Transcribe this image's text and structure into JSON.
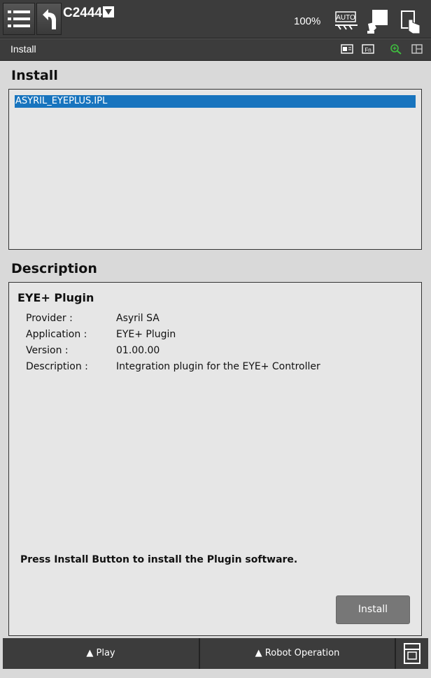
{
  "topbar": {
    "controller": "C2444",
    "speed": "100%",
    "auto_label": "AUTO"
  },
  "titlebar": {
    "title": "Install"
  },
  "install_section": {
    "heading": "Install",
    "files": [
      "ASYRIL_EYEPLUS.IPL"
    ],
    "selected_index": 0
  },
  "description_section": {
    "heading": "Description",
    "plugin_title": "EYE+ Plugin",
    "fields": [
      {
        "label": "Provider :",
        "value": "Asyril SA"
      },
      {
        "label": "Application :",
        "value": "EYE+ Plugin"
      },
      {
        "label": "Version :",
        "value": "01.00.00"
      },
      {
        "label": "Description :",
        "value": "Integration plugin for the EYE+ Controller"
      }
    ],
    "hint": "Press Install Button to install the Plugin software.",
    "install_button": "Install"
  },
  "bottombar": {
    "play": "▲ Play",
    "robot_operation": "▲ Robot Operation"
  },
  "colors": {
    "bar": "#3c3c3c",
    "selection": "#1874be",
    "button": "#777777"
  }
}
